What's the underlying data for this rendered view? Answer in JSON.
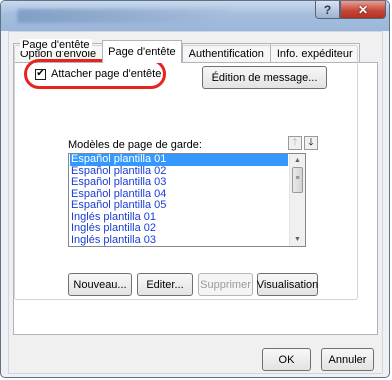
{
  "titlebar": {
    "help_label": "?",
    "close_label": "✕"
  },
  "tabs": [
    {
      "label": "Option d'envoie",
      "active": false
    },
    {
      "label": "Page d'entête",
      "active": true
    },
    {
      "label": "Authentification",
      "active": false
    },
    {
      "label": "Info. expéditeur",
      "active": false
    }
  ],
  "group": {
    "title": "Page d'entête",
    "attach_checkbox": {
      "label": "Attacher page d'entête",
      "checked": true,
      "mark": "✔"
    },
    "edit_message_button": "Édition de message...",
    "templates_label": "Modèles de page de garde:",
    "move_up_icon": "🡑",
    "move_down_icon": "🡓",
    "templates": [
      "Español plantilla 01",
      "Español plantilla 02",
      "Español plantilla 03",
      "Español plantilla 04",
      "Español plantilla 05",
      "Inglés plantilla 01",
      "Inglés plantilla 02",
      "Inglés plantilla 03"
    ],
    "selected_index": 0,
    "buttons": {
      "new": "Nouveau...",
      "edit": "Editer...",
      "delete": "Supprimer",
      "preview": "Visualisation"
    }
  },
  "footer": {
    "ok": "OK",
    "cancel": "Annuler"
  },
  "colors": {
    "highlight": "#e8221d",
    "selection": "#3399ff",
    "item_text": "#1a3cd6"
  }
}
